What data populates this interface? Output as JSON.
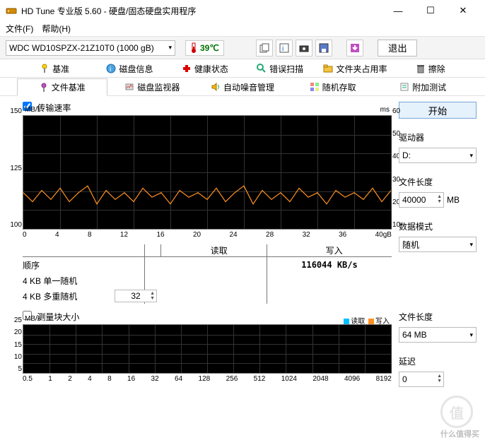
{
  "title": "HD Tune 专业版 5.60 - 硬盘/固态硬盘实用程序",
  "menu": {
    "file": "文件(F)",
    "help": "帮助(H)"
  },
  "toolbar": {
    "drive": "WDC WD10SPZX-21Z10T0 (1000 gB)",
    "temp": "39℃",
    "exit": "退出"
  },
  "tabs1": {
    "benchmark": "基准",
    "info": "磁盘信息",
    "health": "健康状态",
    "errorscan": "错误扫描",
    "folder": "文件夹占用率",
    "erase": "擦除"
  },
  "tabs2": {
    "filebench": "文件基准",
    "monitor": "磁盘监视器",
    "aam": "自动噪音管理",
    "random": "随机存取",
    "extra": "附加测试"
  },
  "panel": {
    "transfer_label": "传输速率",
    "unit_l": "MB/s",
    "unit_r": "ms",
    "xunit": "gB",
    "read_hdr": "读取",
    "write_hdr": "写入",
    "seq_label": "顺序",
    "write_val": "116044 KB/s",
    "r4ksingle": "4 KB 单一随机",
    "r4kmulti": "4 KB 多重随机",
    "queue_depth": "32",
    "blocksize_label": "测量块大小",
    "legend_read": "读取",
    "legend_write": "写入"
  },
  "side": {
    "start": "开始",
    "driver_label": "驱动器",
    "driver_value": "D:",
    "filelen_label": "文件长度",
    "filelen_value": "40000",
    "filelen_unit": "MB",
    "datamode_label": "数据模式",
    "datamode_value": "随机",
    "filelen2_label": "文件长度",
    "filelen2_value": "64 MB",
    "delay_label": "延迟",
    "delay_value": "0"
  },
  "watermark": "什么值得买",
  "chart_data": {
    "type": "line",
    "x": [
      0,
      4,
      8,
      12,
      16,
      20,
      24,
      28,
      32,
      36,
      40
    ],
    "ylabel_left": "MB/s",
    "ylim_left": [
      100,
      150
    ],
    "yticks_left": [
      100,
      125,
      150
    ],
    "ylabel_right": "ms",
    "ylim_right": [
      0,
      60
    ],
    "yticks_right": [
      10,
      20,
      30,
      40,
      50,
      60
    ],
    "xunit": "gB",
    "series": [
      {
        "name": "写入",
        "color": "#ff9020",
        "values": [
          116,
          112,
          117,
          113,
          118,
          112,
          116,
          119,
          111,
          117,
          113,
          116,
          112,
          118,
          114,
          116,
          111,
          117,
          114,
          116,
          113,
          118,
          112,
          116,
          119,
          111,
          117,
          113,
          116,
          112,
          118,
          114,
          116,
          111,
          117,
          114,
          116,
          113,
          118,
          112,
          117
        ]
      }
    ]
  },
  "chart_data2": {
    "type": "bar",
    "xticks": [
      0.5,
      1,
      2,
      4,
      8,
      16,
      32,
      64,
      128,
      256,
      512,
      1024,
      2048,
      4096,
      8192
    ],
    "ylabel": "MB/s",
    "ylim": [
      0,
      25
    ],
    "yticks": [
      5,
      10,
      15,
      20,
      25
    ],
    "series": [
      {
        "name": "读取",
        "values": []
      },
      {
        "name": "写入",
        "values": []
      }
    ]
  }
}
